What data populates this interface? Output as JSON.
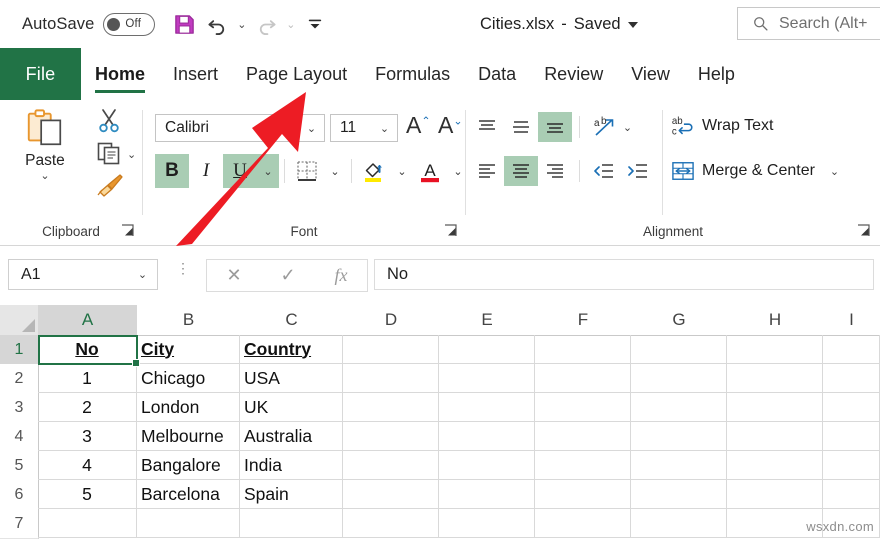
{
  "titlebar": {
    "autosave_label": "AutoSave",
    "autosave_state": "Off",
    "save_icon": "save-icon",
    "undo_icon": "undo-icon",
    "redo_icon": "redo-icon",
    "customize_qat_icon": "chevron-down-icon",
    "document_name": "Cities.xlsx",
    "separator": "-",
    "save_status": "Saved"
  },
  "search": {
    "icon": "search-icon",
    "placeholder": "Search (Alt+"
  },
  "tabs": [
    {
      "label": "File",
      "active": false,
      "file": true
    },
    {
      "label": "Home",
      "active": true
    },
    {
      "label": "Insert",
      "active": false
    },
    {
      "label": "Page Layout",
      "active": false
    },
    {
      "label": "Formulas",
      "active": false
    },
    {
      "label": "Data",
      "active": false
    },
    {
      "label": "Review",
      "active": false
    },
    {
      "label": "View",
      "active": false
    },
    {
      "label": "Help",
      "active": false
    }
  ],
  "ribbon": {
    "clipboard": {
      "label": "Clipboard",
      "paste_label": "Paste",
      "paste_icon": "paste-icon",
      "paste_chevron": "chevron-down-icon",
      "cut_icon": "scissors-icon",
      "copy_icon": "copy-icon",
      "copy_chevron": "chevron-down-icon",
      "format_painter_icon": "format-painter-icon",
      "launcher_icon": "dialog-launcher-icon"
    },
    "font": {
      "label": "Font",
      "font_name": "Calibri",
      "font_size": "11",
      "font_name_chevron": "chevron-down-icon",
      "font_size_chevron": "chevron-down-icon",
      "grow_font_icon": "grow-font-icon",
      "shrink_font_icon": "shrink-font-icon",
      "bold_label": "B",
      "italic_label": "I",
      "underline_label": "U",
      "underline_chevron": "chevron-down-icon",
      "borders_icon": "borders-icon",
      "borders_chevron": "chevron-down-icon",
      "fill_color_icon": "fill-color-icon",
      "fill_chevron": "chevron-down-icon",
      "font_color_icon": "font-color-icon",
      "font_color_chevron": "chevron-down-icon",
      "launcher_icon": "dialog-launcher-icon",
      "bold_active": true,
      "underline_active": true
    },
    "alignment": {
      "label": "Alignment",
      "align_top_icon": "align-top-icon",
      "align_middle_icon": "align-middle-icon",
      "align_bottom_icon": "align-bottom-icon",
      "orientation_icon": "orientation-icon",
      "orientation_chevron": "chevron-down-icon",
      "align_left_icon": "align-left-icon",
      "align_center_icon": "align-center-icon",
      "align_right_icon": "align-right-icon",
      "decrease_indent_icon": "decrease-indent-icon",
      "increase_indent_icon": "increase-indent-icon",
      "wrap_text_label": "Wrap Text",
      "wrap_text_icon": "wrap-text-icon",
      "merge_center_label": "Merge & Center",
      "merge_center_icon": "merge-center-icon",
      "merge_chevron": "chevron-down-icon",
      "launcher_icon": "dialog-launcher-icon",
      "align_bottom_active": true,
      "align_center_active": true
    }
  },
  "formula_bar": {
    "name_box_value": "A1",
    "name_box_chevron": "chevron-down-icon",
    "more_icon": "more-vertical-icon",
    "cancel_icon": "cancel-icon",
    "enter_icon": "enter-icon",
    "function_icon": "fx-icon",
    "formula_value": "No"
  },
  "grid": {
    "columns": [
      "A",
      "B",
      "C",
      "D",
      "E",
      "F",
      "G",
      "H",
      "I"
    ],
    "rows": [
      "1",
      "2",
      "3",
      "4",
      "5",
      "6",
      "7"
    ],
    "selected_cell": "A1",
    "selected_column": "A",
    "selected_row": "1",
    "data": [
      {
        "A": "No",
        "B": "City",
        "C": "Country",
        "header": true
      },
      {
        "A": "1",
        "B": "Chicago",
        "C": "USA"
      },
      {
        "A": "2",
        "B": "London",
        "C": "UK"
      },
      {
        "A": "3",
        "B": "Melbourne",
        "C": "Australia"
      },
      {
        "A": "4",
        "B": "Bangalore",
        "C": "India"
      },
      {
        "A": "5",
        "B": "Barcelona",
        "C": "Spain"
      },
      {
        "A": "",
        "B": "",
        "C": ""
      }
    ],
    "watermark": "wsxdn.com"
  },
  "annotation": {
    "arrow_color": "#ED1C24",
    "points_to": "Page Layout"
  },
  "colors": {
    "excel_green": "#217346",
    "highlight_green": "#a9cdb4",
    "save_purple": "#C13BC1",
    "accent_blue": "#1a6fb5"
  }
}
